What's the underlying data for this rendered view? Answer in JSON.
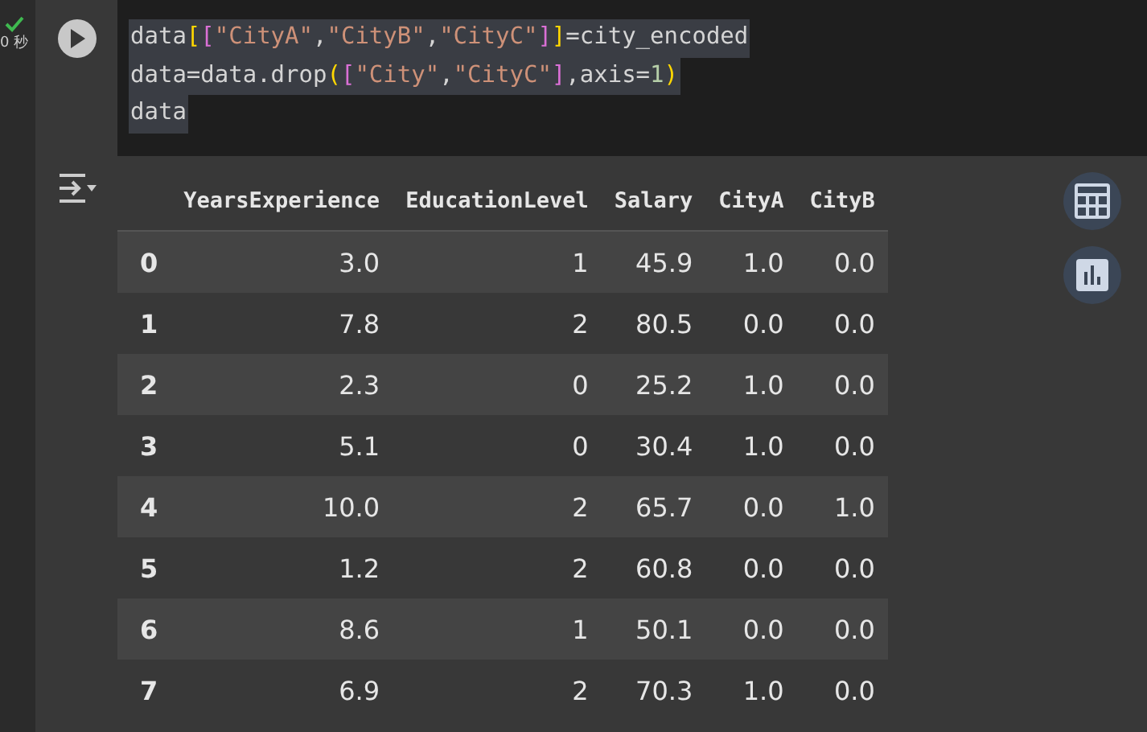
{
  "cell_status": {
    "done": true,
    "time": "0 秒"
  },
  "code_lines": [
    [
      {
        "kind": "plain",
        "text": "data"
      },
      {
        "kind": "bracket1",
        "text": "["
      },
      {
        "kind": "bracket2",
        "text": "["
      },
      {
        "kind": "string",
        "text": "\"CityA\""
      },
      {
        "kind": "plain",
        "text": ","
      },
      {
        "kind": "string",
        "text": "\"CityB\""
      },
      {
        "kind": "plain",
        "text": ","
      },
      {
        "kind": "string",
        "text": "\"CityC\""
      },
      {
        "kind": "bracket2",
        "text": "]"
      },
      {
        "kind": "bracket1",
        "text": "]"
      },
      {
        "kind": "plain",
        "text": "=city_encoded"
      }
    ],
    [
      {
        "kind": "plain",
        "text": "data=data.drop"
      },
      {
        "kind": "bracket1",
        "text": "("
      },
      {
        "kind": "bracket2",
        "text": "["
      },
      {
        "kind": "string",
        "text": "\"City\""
      },
      {
        "kind": "plain",
        "text": ","
      },
      {
        "kind": "string",
        "text": "\"CityC\""
      },
      {
        "kind": "bracket2",
        "text": "]"
      },
      {
        "kind": "plain",
        "text": ",axis="
      },
      {
        "kind": "number",
        "text": "1"
      },
      {
        "kind": "bracket1",
        "text": ")"
      }
    ],
    [
      {
        "kind": "plain",
        "text": "data"
      }
    ]
  ],
  "table": {
    "columns": [
      "",
      "YearsExperience",
      "EducationLevel",
      "Salary",
      "CityA",
      "CityB"
    ],
    "rows": [
      [
        "0",
        "3.0",
        "1",
        "45.9",
        "1.0",
        "0.0"
      ],
      [
        "1",
        "7.8",
        "2",
        "80.5",
        "0.0",
        "0.0"
      ],
      [
        "2",
        "2.3",
        "0",
        "25.2",
        "1.0",
        "0.0"
      ],
      [
        "3",
        "5.1",
        "0",
        "30.4",
        "1.0",
        "0.0"
      ],
      [
        "4",
        "10.0",
        "2",
        "65.7",
        "0.0",
        "1.0"
      ],
      [
        "5",
        "1.2",
        "2",
        "60.8",
        "0.0",
        "0.0"
      ],
      [
        "6",
        "8.6",
        "1",
        "50.1",
        "0.0",
        "0.0"
      ],
      [
        "7",
        "6.9",
        "2",
        "70.3",
        "1.0",
        "0.0"
      ]
    ]
  }
}
